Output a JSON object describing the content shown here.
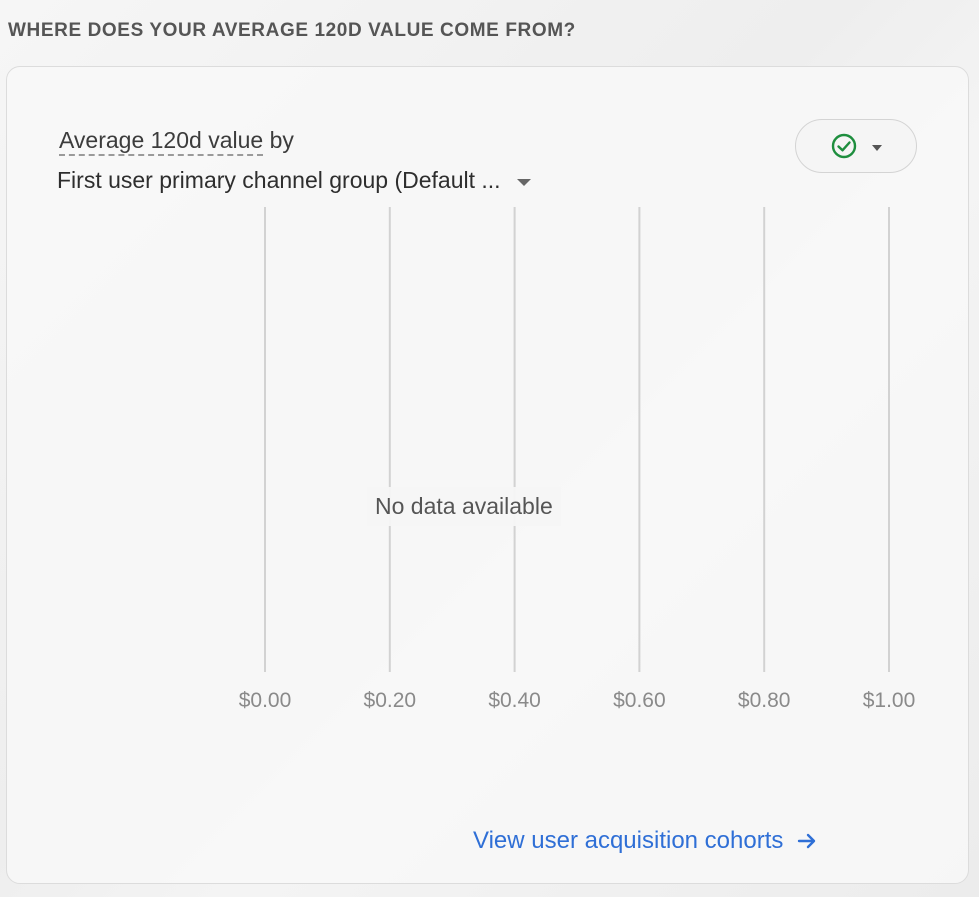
{
  "section": {
    "title": "WHERE DOES YOUR AVERAGE 120D VALUE COME FROM?"
  },
  "card": {
    "metric_label": "Average 120d value",
    "metric_suffix": " by",
    "dimension_label": "First user primary channel group (Default ...",
    "dimension_caret_icon": "caret-down-icon",
    "status_icon": "check-circle-icon",
    "status_caret_icon": "caret-down-icon",
    "status_color": "#1e8e3e",
    "no_data_text": "No data available",
    "link_text": "View user acquisition cohorts",
    "link_icon": "arrow-right-icon",
    "link_color": "#2f6fd6"
  },
  "chart_data": {
    "type": "bar",
    "categories": [],
    "values": [],
    "x_tick_labels": [
      "$0.00",
      "$0.20",
      "$0.40",
      "$0.60",
      "$0.80",
      "$1.00"
    ],
    "x_ticks": [
      0,
      0.2,
      0.4,
      0.6,
      0.8,
      1.0
    ],
    "xlim": [
      0,
      1.0
    ],
    "grid": true,
    "orientation": "horizontal"
  }
}
